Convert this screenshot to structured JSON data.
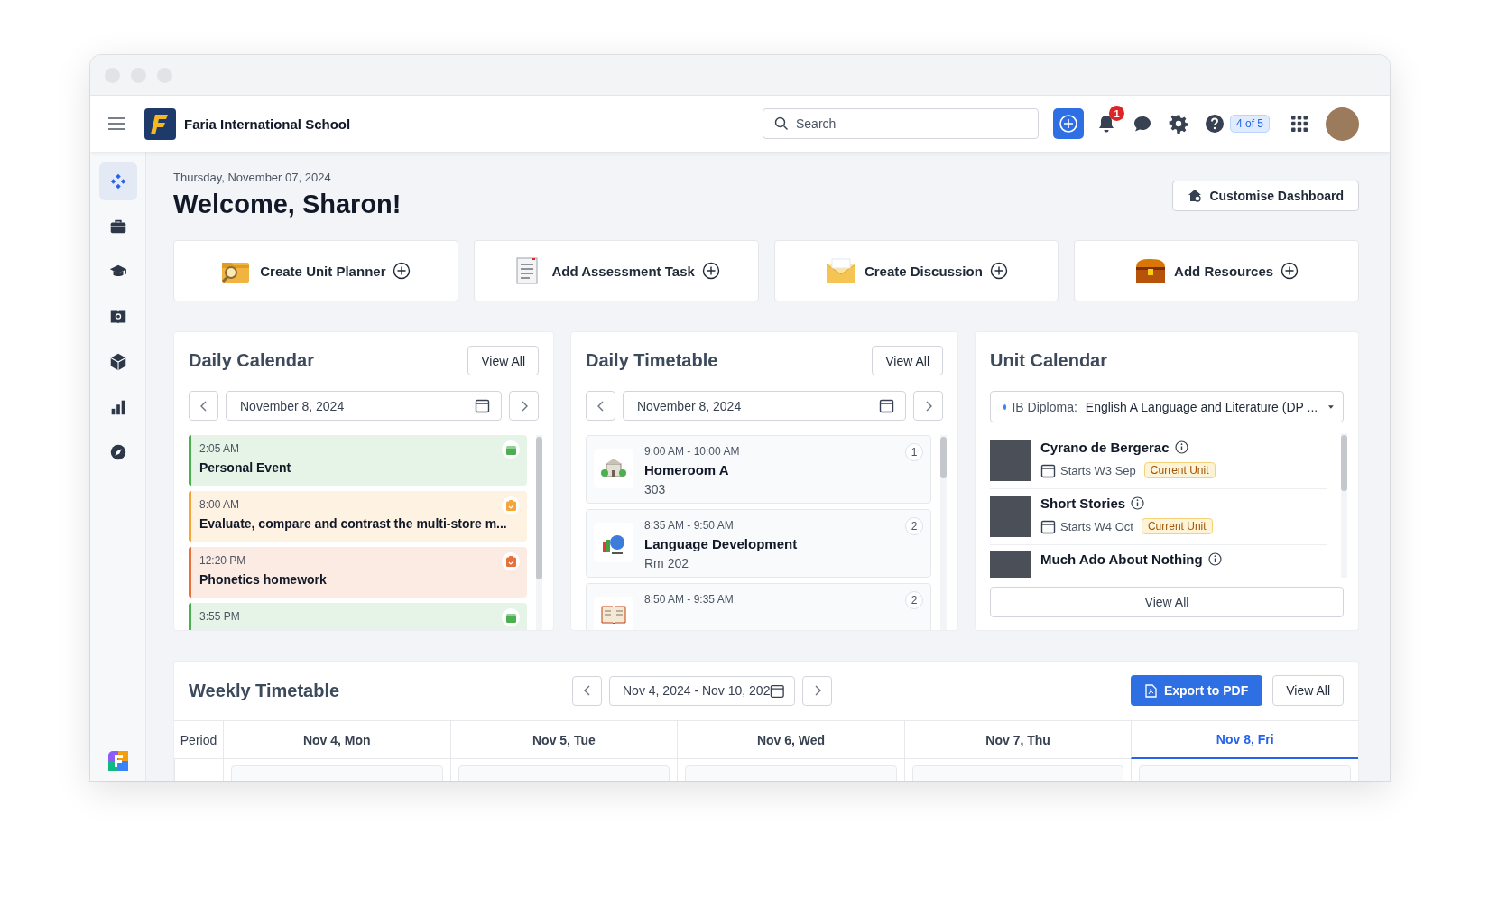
{
  "header": {
    "school_name": "Faria International School",
    "search": {
      "placeholder": "Search"
    },
    "notification_count": "1",
    "help_badge": "4 of 5"
  },
  "sidebar": {
    "items": [
      {
        "kind": "dashboard",
        "selected": true
      },
      {
        "kind": "briefcase",
        "selected": false
      },
      {
        "kind": "graduation",
        "selected": false
      },
      {
        "kind": "book",
        "selected": false
      },
      {
        "kind": "cube",
        "selected": false
      },
      {
        "kind": "chart",
        "selected": false
      },
      {
        "kind": "compass",
        "selected": false
      }
    ]
  },
  "date": "Thursday, November 07, 2024",
  "welcome": "Welcome, Sharon!",
  "customise_button": "Customise Dashboard",
  "quick_actions": [
    {
      "kind": "unit-planner",
      "label": "Create Unit Planner"
    },
    {
      "kind": "assessment",
      "label": "Add Assessment Task"
    },
    {
      "kind": "discussion",
      "label": "Create Discussion"
    },
    {
      "kind": "resources",
      "label": "Add Resources"
    }
  ],
  "daily_calendar": {
    "title": "Daily Calendar",
    "view_all": "View All",
    "date": "November 8, 2024",
    "events": [
      {
        "kind": "event",
        "time": "2:05 AM",
        "title": "Personal Event",
        "color": "#4caf50"
      },
      {
        "kind": "task",
        "time": "8:00 AM",
        "title": "Evaluate, compare and contrast the multi-store m...",
        "color": "#f5a53a"
      },
      {
        "kind": "task",
        "time": "12:20 PM",
        "title": "Phonetics homework",
        "color": "#e8703a"
      },
      {
        "kind": "event",
        "time": "3:55 PM",
        "color": "#4caf50"
      }
    ]
  },
  "daily_timetable": {
    "title": "Daily Timetable",
    "view_all": "View All",
    "date": "November 8, 2024",
    "classes": [
      {
        "kind": "building",
        "time": "9:00 AM - 10:00 AM",
        "title": "Homeroom A",
        "room": "303",
        "period": "1"
      },
      {
        "kind": "globe",
        "time": "8:35 AM - 9:50 AM",
        "title": "Language Development",
        "room": "Rm 202",
        "period": "2"
      },
      {
        "kind": "book",
        "time": "8:50 AM - 9:35 AM",
        "period": "2"
      }
    ]
  },
  "unit_calendar": {
    "title": "Unit Calendar",
    "filter": {
      "color": "#3b82f6",
      "program": "IB Diploma:",
      "course": "English A Language and Literature (DP ..."
    },
    "units": [
      {
        "title": "Cyrano de Bergerac",
        "starts": "Starts W3 Sep",
        "badge": "Current Unit"
      },
      {
        "title": "Short Stories",
        "starts": "Starts W4 Oct",
        "badge": "Current Unit"
      },
      {
        "title": "Much Ado About Nothing"
      }
    ],
    "view_all": "View All"
  },
  "weekly_timetable": {
    "title": "Weekly Timetable",
    "date_range": "Nov 4, 2024 - Nov 10, 202",
    "export_button": "Export to PDF",
    "view_all": "View All",
    "columns": [
      {
        "label": "Period",
        "selected": false
      },
      {
        "label": "Nov 4, Mon",
        "selected": false
      },
      {
        "label": "Nov 5, Tue",
        "selected": false
      },
      {
        "label": "Nov 6, Wed",
        "selected": false
      },
      {
        "label": "Nov 7, Thu",
        "selected": false
      },
      {
        "label": "Nov 8, Fri",
        "selected": true
      }
    ]
  }
}
